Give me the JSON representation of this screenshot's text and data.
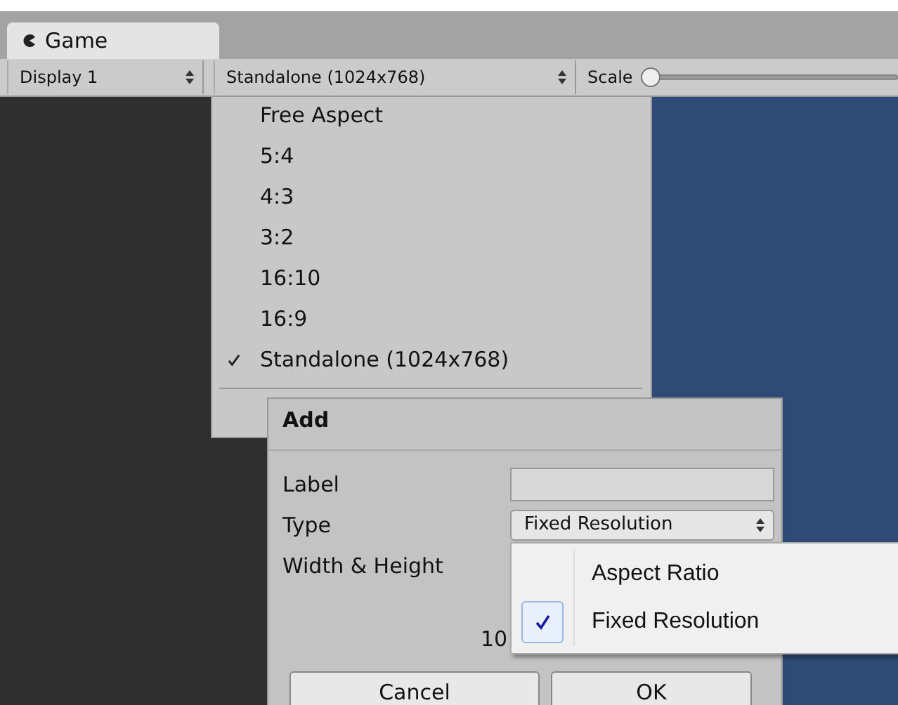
{
  "tabs": [
    {
      "label": "Game",
      "selected": true
    }
  ],
  "toolbar": {
    "display": "Display 1",
    "aspect": "Standalone (1024x768)",
    "scale_label": "Scale",
    "scale": {
      "level": 0
    }
  },
  "aspect_menu": {
    "items": [
      {
        "label": "Free Aspect",
        "selected": false
      },
      {
        "label": "5:4",
        "selected": false
      },
      {
        "label": "4:3",
        "selected": false
      },
      {
        "label": "3:2",
        "selected": false
      },
      {
        "label": "16:10",
        "selected": false
      },
      {
        "label": "16:9",
        "selected": false
      },
      {
        "label": "Standalone (1024x768)",
        "selected": true
      }
    ]
  },
  "add_dialog": {
    "title": "Add",
    "label_field": {
      "label": "Label"
    },
    "type_field": {
      "label": "Type",
      "value": "Fixed Resolution"
    },
    "size_field": {
      "label": "Width & Height",
      "value_partial": "10"
    },
    "buttons": [
      "Cancel",
      "OK"
    ]
  },
  "type_menu": {
    "items": [
      {
        "label": "Aspect Ratio",
        "selected": false
      },
      {
        "label": "Fixed Resolution",
        "selected": true
      }
    ]
  }
}
